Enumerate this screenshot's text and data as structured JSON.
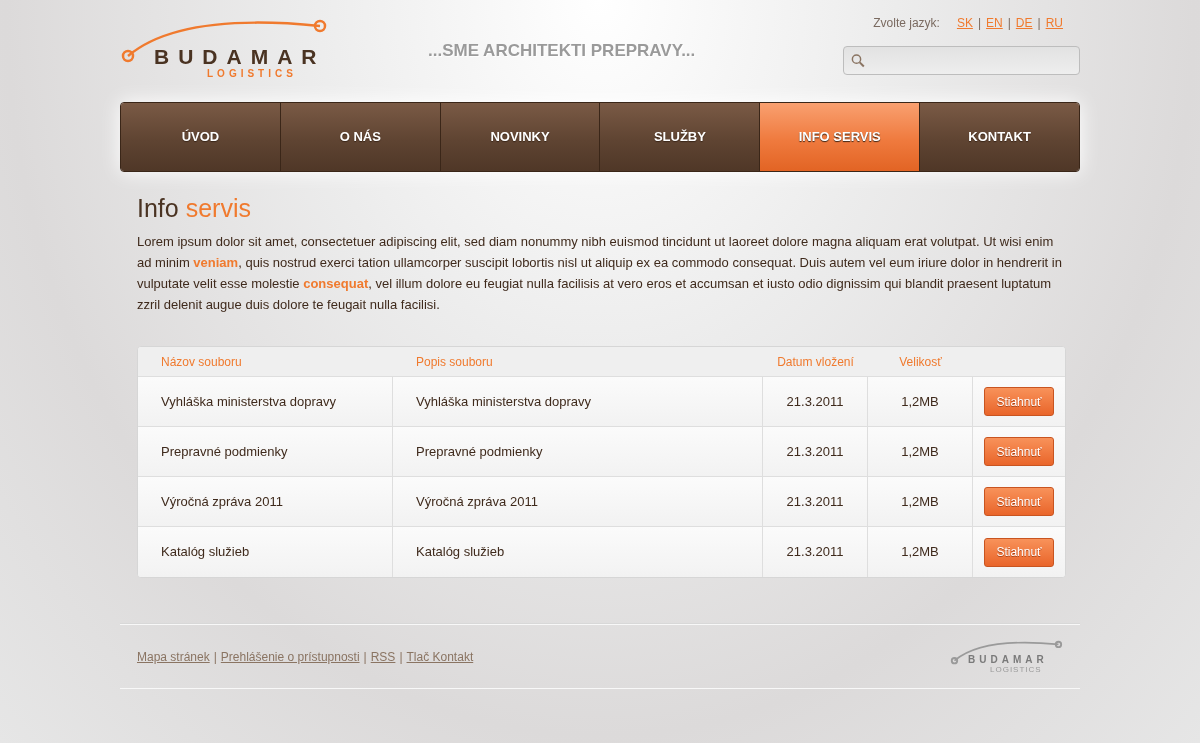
{
  "header": {
    "logo_name": "BUDAMAR",
    "logo_sub": "LOGISTICS",
    "tagline": "...SME ARCHITEKTI PREPRAVY...",
    "language_label": "Zvolte jazyk:",
    "separator": "|",
    "languages": [
      {
        "label": "SK"
      },
      {
        "label": "EN"
      },
      {
        "label": "DE"
      },
      {
        "label": "RU"
      }
    ]
  },
  "nav": [
    {
      "label": "ÚVOD",
      "selected": false
    },
    {
      "label": "O NÁS",
      "selected": false
    },
    {
      "label": "NOVINKY",
      "selected": false
    },
    {
      "label": "SLUŽBY",
      "selected": false
    },
    {
      "label": "INFO SERVIS",
      "selected": true
    },
    {
      "label": "KONTAKT",
      "selected": false
    }
  ],
  "page": {
    "title_lead": "Info",
    "title_accent": "servis",
    "intro": "Lorem ipsum dolor sit amet, consectetuer adipiscing elit, sed diam nonummy nibh euismod tincidunt ut laoreet dolore magna aliquam erat volutpat. Ut wisi enim ad minim **veniam**, quis nostrud exerci tation ullamcorper suscipit lobortis nisl ut aliquip ex ea commodo consequat. Duis autem vel eum iriure dolor in hendrerit in vulputate velit esse molestie **consequat**, vel illum dolore eu feugiat nulla facilisis at vero eros et accumsan et iusto odio dignissim qui blandit praesent luptatum zzril delenit augue duis dolore te feugait nulla facilisi."
  },
  "table": {
    "columns": [
      "Názov souboru",
      "Popis souboru",
      "Datum vložení",
      "Velikosť"
    ],
    "rows": [
      {
        "name": "Vyhláška ministerstva dopravy",
        "description": "Vyhláška ministerstva dopravy",
        "date": "21.3.2011",
        "size": "1,2MB",
        "button": "Stiahnuť"
      },
      {
        "name": "Prepravné podmienky",
        "description": "Prepravné podmienky",
        "date": "21.3.2011",
        "size": "1,2MB",
        "button": "Stiahnuť"
      },
      {
        "name": "Výročná zpráva 2011",
        "description": "Výročná zpráva 2011",
        "date": "21.3.2011",
        "size": "1,2MB",
        "button": "Stiahnuť"
      },
      {
        "name": "Katalóg služieb",
        "description": "Katalóg služieb",
        "date": "21.3.2011",
        "size": "1,2MB",
        "button": "Stiahnuť"
      }
    ]
  },
  "footer": {
    "links": [
      "Mapa stránek",
      "Prehlášenie o prístupnosti",
      "RSS",
      "Tlač Kontakt"
    ],
    "separator": "|",
    "logo_name": "BUDAMAR",
    "logo_sub": "LOGISTICS"
  }
}
